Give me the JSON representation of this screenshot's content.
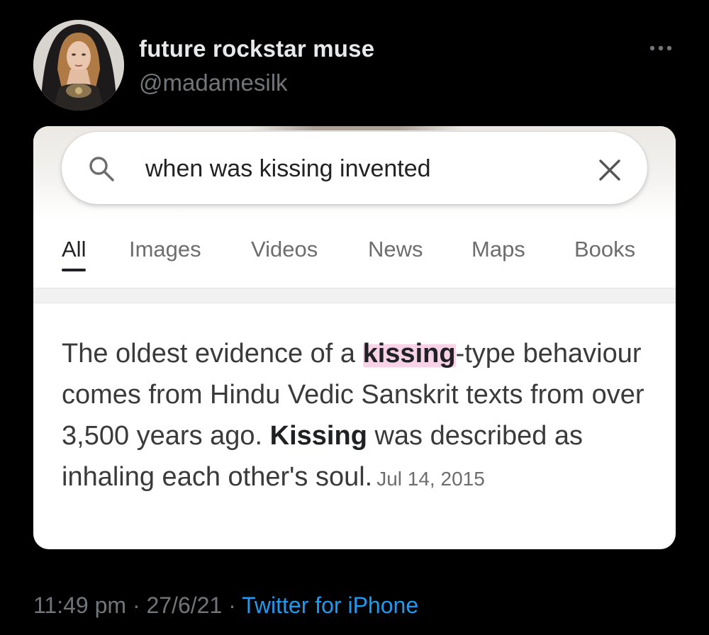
{
  "tweet": {
    "author": {
      "display_name": "future rockstar muse",
      "handle": "@madamesilk"
    },
    "time": "11:49 pm",
    "separator": "·",
    "date": "27/6/21",
    "source": "Twitter for iPhone"
  },
  "embedded_screenshot": {
    "search": {
      "query": "when was kissing invented"
    },
    "tabs": [
      "All",
      "Images",
      "Videos",
      "News",
      "Maps",
      "Books"
    ],
    "active_tab": "All",
    "snippet": {
      "part1": "The oldest evidence of a ",
      "bold1": "kissing",
      "part2": "-type behaviour comes from Hindu Vedic Sanskrit texts from over 3,500 years ago. ",
      "bold2": "Kissing",
      "part3": " was described as inhaling each other's soul.",
      "date": "Jul 14, 2015"
    }
  },
  "colors": {
    "background": "#000000",
    "name": "#e7e9ea",
    "muted": "#71767b",
    "link": "#1d9bf0",
    "highlight": "#ee96c8"
  },
  "icons": [
    "more-icon",
    "search-icon",
    "close-icon"
  ]
}
